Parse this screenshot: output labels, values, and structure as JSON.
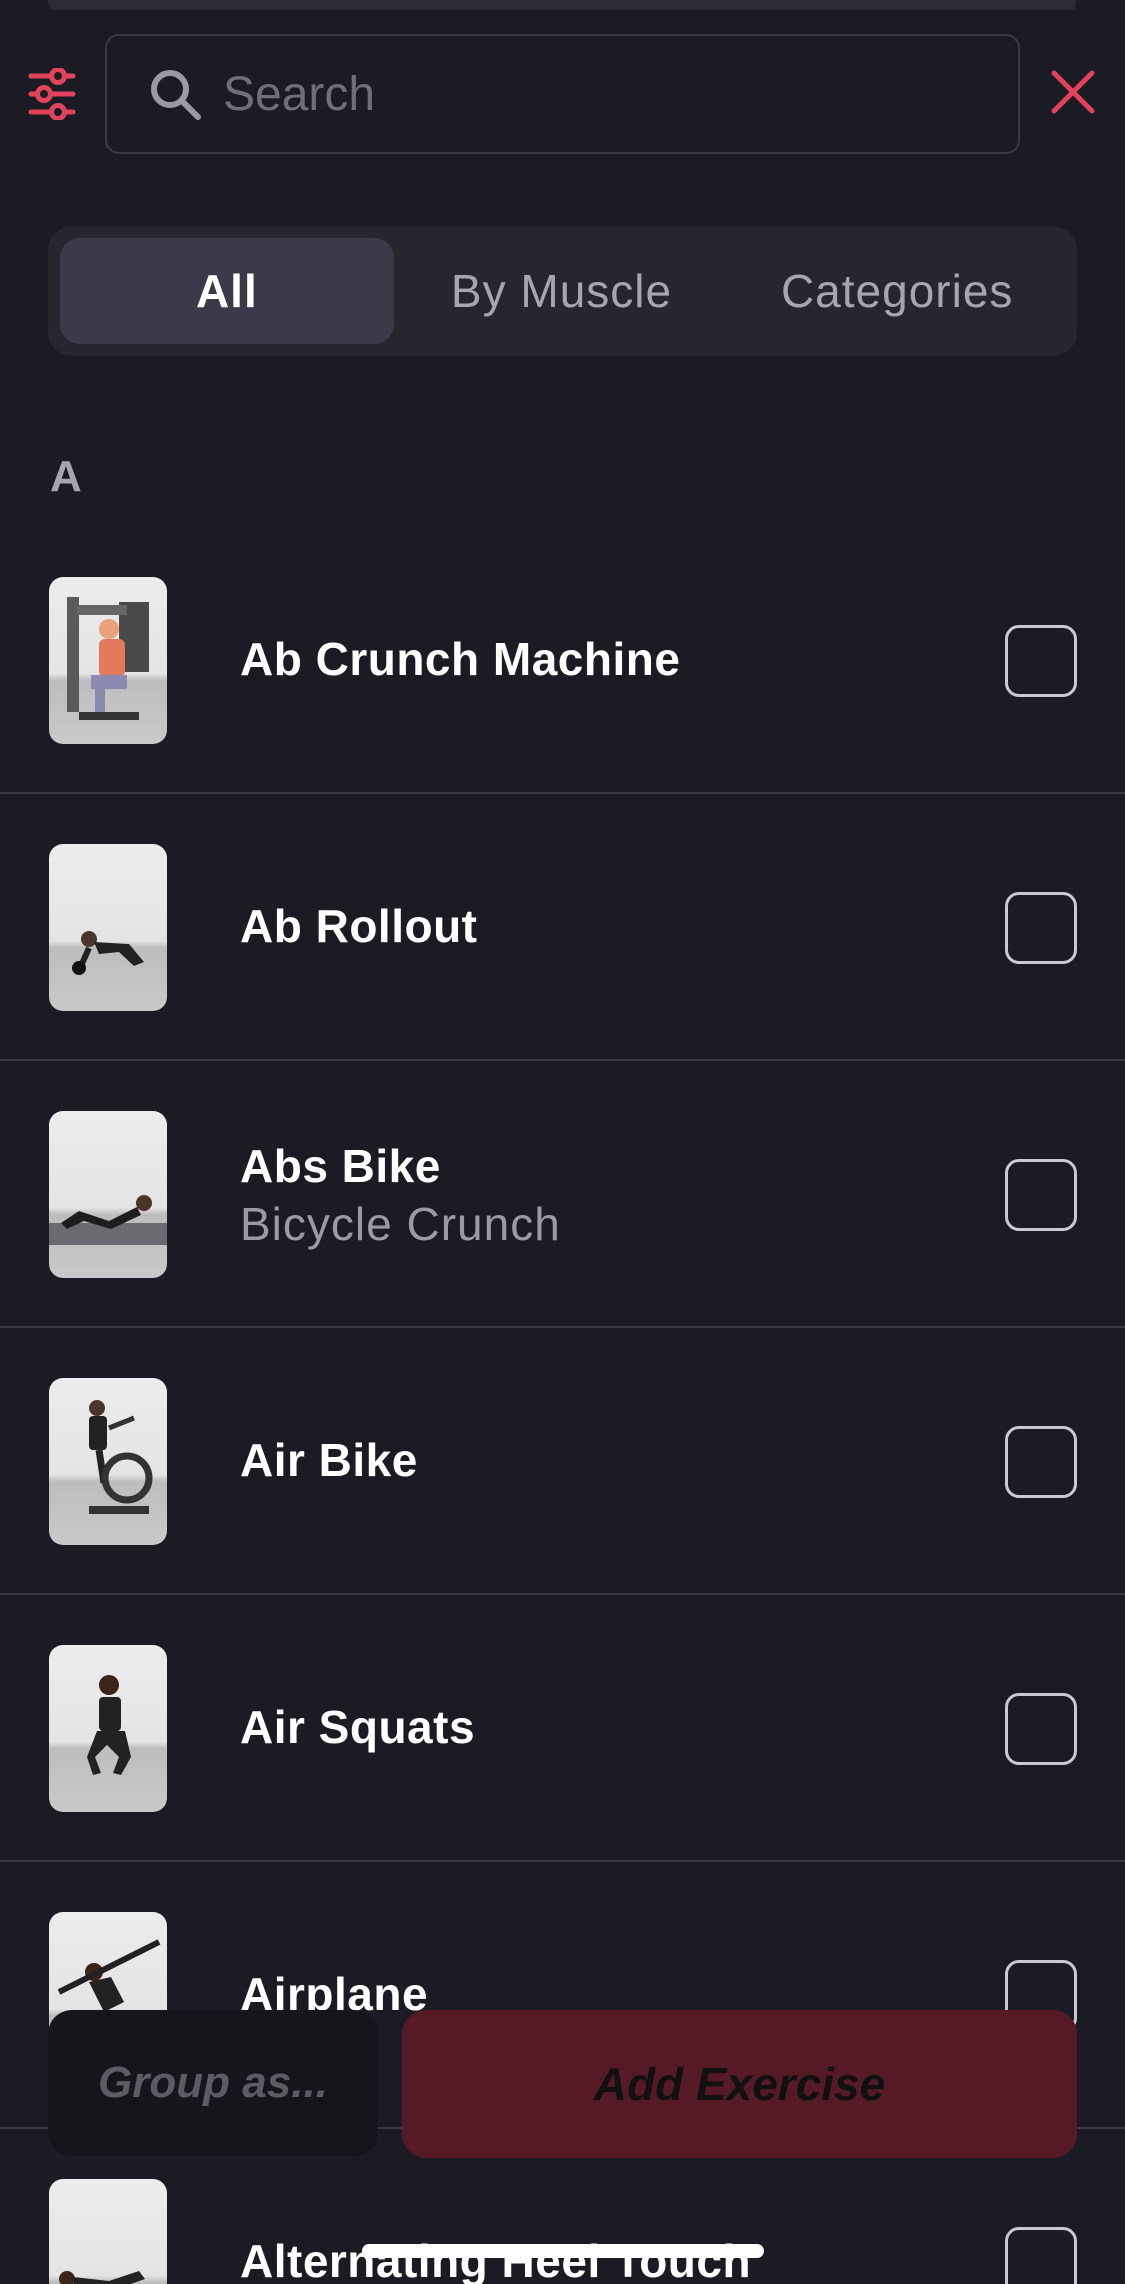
{
  "header": {
    "search_placeholder": "Search",
    "filter_icon": "sliders-icon",
    "search_icon": "magnifier-icon",
    "close_icon": "close-icon",
    "accent_color": "#e0435a"
  },
  "tabs": [
    {
      "label": "All",
      "active": true
    },
    {
      "label": "By Muscle",
      "active": false
    },
    {
      "label": "Categories",
      "active": false
    }
  ],
  "section_letter": "A",
  "exercises": [
    {
      "title": "Ab Crunch Machine",
      "subtitle": "",
      "checked": false
    },
    {
      "title": "Ab Rollout",
      "subtitle": "",
      "checked": false
    },
    {
      "title": "Abs Bike",
      "subtitle": "Bicycle Crunch",
      "checked": false
    },
    {
      "title": "Air Bike",
      "subtitle": "",
      "checked": false
    },
    {
      "title": "Air Squats",
      "subtitle": "",
      "checked": false
    },
    {
      "title": "Airplane",
      "subtitle": "",
      "checked": false
    },
    {
      "title": "Alternating Heel Touch",
      "subtitle": "",
      "checked": false
    }
  ],
  "footer": {
    "group_label": "Group as...",
    "add_label": "Add Exercise"
  }
}
